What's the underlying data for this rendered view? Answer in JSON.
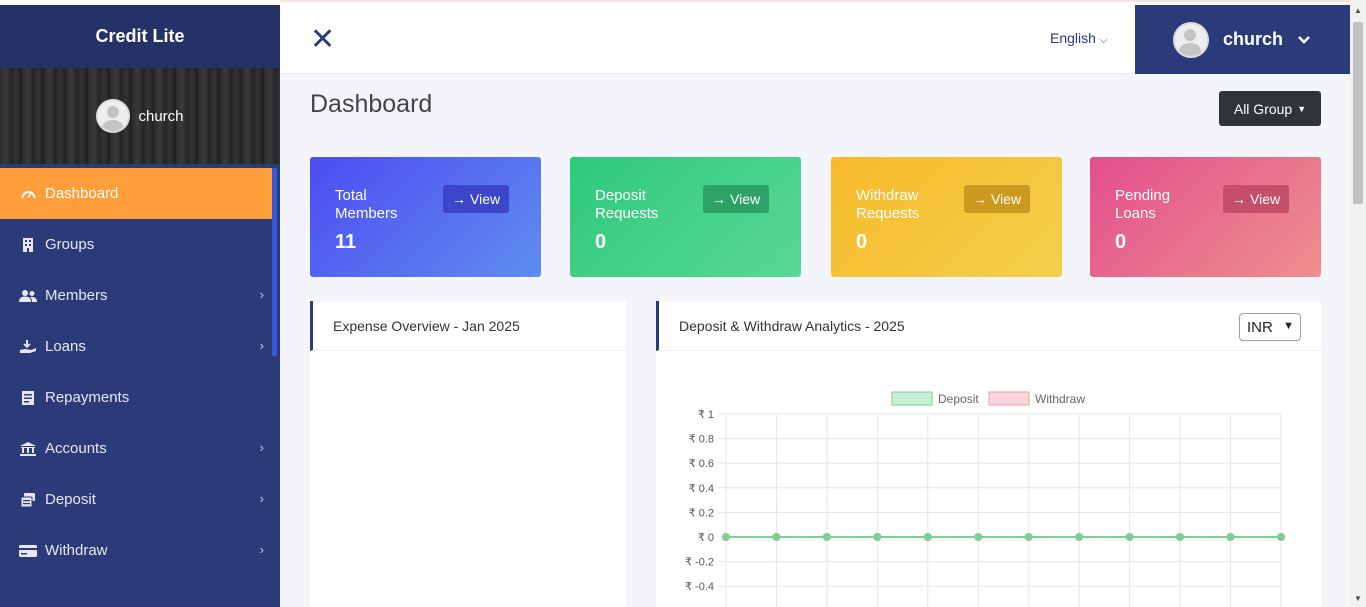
{
  "app": {
    "title": "Credit Lite"
  },
  "sidebar": {
    "user": {
      "name": "church"
    },
    "items": [
      {
        "label": "Dashboard",
        "icon": "dashboard-icon",
        "active": true,
        "has_submenu": false
      },
      {
        "label": "Groups",
        "icon": "building-icon",
        "active": false,
        "has_submenu": false
      },
      {
        "label": "Members",
        "icon": "users-icon",
        "active": false,
        "has_submenu": true
      },
      {
        "label": "Loans",
        "icon": "hand-coin-icon",
        "active": false,
        "has_submenu": true
      },
      {
        "label": "Repayments",
        "icon": "receipt-icon",
        "active": false,
        "has_submenu": false
      },
      {
        "label": "Accounts",
        "icon": "bank-icon",
        "active": false,
        "has_submenu": true
      },
      {
        "label": "Deposit",
        "icon": "money-stack-icon",
        "active": false,
        "has_submenu": true
      },
      {
        "label": "Withdraw",
        "icon": "card-icon",
        "active": false,
        "has_submenu": true
      }
    ]
  },
  "header": {
    "language": "English",
    "user_name": "church"
  },
  "main": {
    "page_title": "Dashboard",
    "group_filter": "All Group",
    "cards": [
      {
        "label": "Total Members",
        "value": "11",
        "view": "View",
        "color": "#4d4cf0"
      },
      {
        "label": "Deposit Requests",
        "value": "0",
        "view": "View",
        "color": "#2ec97c"
      },
      {
        "label": "Withdraw Requests",
        "value": "0",
        "view": "View",
        "color": "#f7ba2b"
      },
      {
        "label": "Pending Loans",
        "value": "0",
        "view": "View",
        "color": "#e34f8c"
      }
    ],
    "expense_panel": {
      "title": "Expense Overview - Jan 2025"
    },
    "analytics_panel": {
      "title": "Deposit & Withdraw Analytics - 2025",
      "currency": "INR"
    }
  },
  "chart_data": {
    "type": "line",
    "legend_placement": "top-center",
    "grid": true,
    "y_tick_labels": [
      "₹ 1",
      "₹ 0.8",
      "₹ 0.6",
      "₹ 0.4",
      "₹ 0.2",
      "₹ 0",
      "₹ -0.2",
      "₹ -0.4"
    ],
    "ylim": [
      -0.4,
      1
    ],
    "x_points": 12,
    "series": [
      {
        "name": "Deposit",
        "values": [
          0,
          0,
          0,
          0,
          0,
          0,
          0,
          0,
          0,
          0,
          0,
          0
        ],
        "color": "#7fcf94",
        "fill": "#c9efd6"
      },
      {
        "name": "Withdraw",
        "values": [
          0,
          0,
          0,
          0,
          0,
          0,
          0,
          0,
          0,
          0,
          0,
          0
        ],
        "color": "#f29aaa",
        "fill": "#fbd6dd"
      }
    ]
  }
}
